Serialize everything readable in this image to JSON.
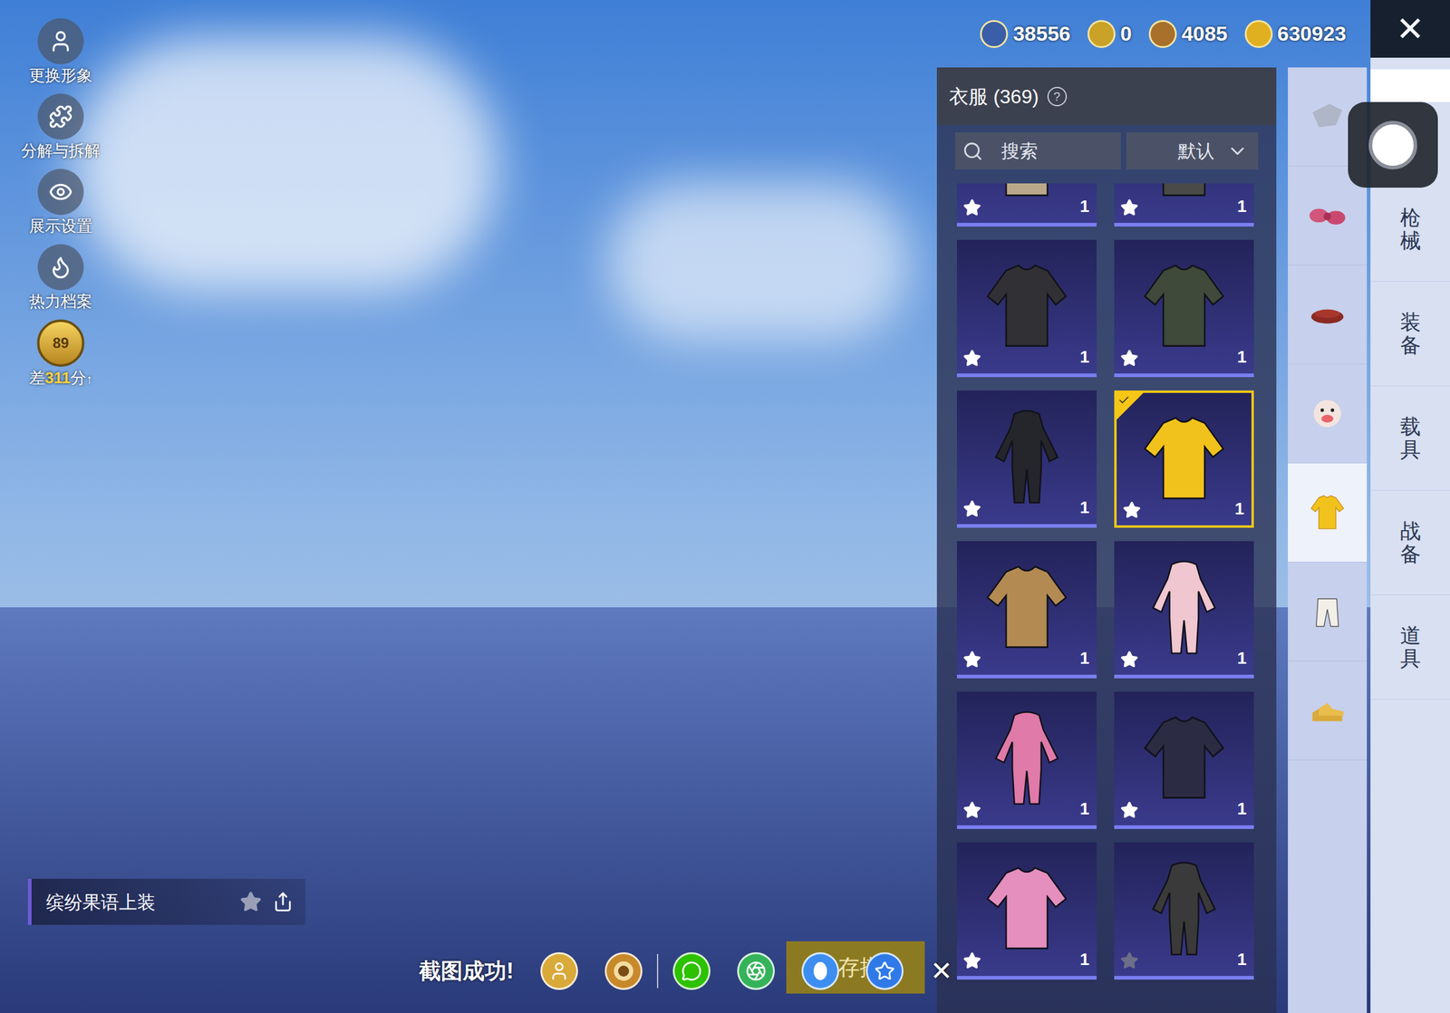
{
  "sidebar": {
    "items": [
      {
        "label": "更换形象",
        "kind": "avatar"
      },
      {
        "label": "分解与拆解",
        "kind": "puzzle"
      },
      {
        "label": "展示设置",
        "kind": "eye"
      },
      {
        "label": "热力档案",
        "kind": "flame"
      }
    ]
  },
  "rank_badge": {
    "level": "89",
    "prefix": "差",
    "points": "311",
    "suffix": "分",
    "arrow": "↑"
  },
  "currencies": [
    {
      "value": "38556",
      "color": "#3b5ea8"
    },
    {
      "value": "0",
      "color": "#c9a227"
    },
    {
      "value": "4085",
      "color": "#a8702a"
    },
    {
      "value": "630923",
      "color": "#e0b020"
    }
  ],
  "close_button": "✕",
  "panel": {
    "title": "衣服 (369)",
    "help": "?",
    "search": {
      "placeholder": "搜索"
    },
    "sort": {
      "value": "默认"
    }
  },
  "items": [
    {
      "kind": "top",
      "color": "#b9a98a",
      "count": "1",
      "starred": true,
      "selected": false
    },
    {
      "kind": "top",
      "color": "#4a4a48",
      "count": "1",
      "starred": true,
      "selected": false
    },
    {
      "kind": "top",
      "color": "#303035",
      "count": "1",
      "starred": true,
      "selected": false
    },
    {
      "kind": "top",
      "color": "#3f4a3a",
      "count": "1",
      "starred": true,
      "selected": false
    },
    {
      "kind": "full",
      "color": "#25262c",
      "count": "1",
      "starred": true,
      "selected": false
    },
    {
      "kind": "top",
      "color": "#f2c21c",
      "count": "1",
      "starred": true,
      "selected": true
    },
    {
      "kind": "top",
      "color": "#b38a52",
      "count": "1",
      "starred": true,
      "selected": false
    },
    {
      "kind": "full",
      "color": "#f0c6d0",
      "count": "1",
      "starred": true,
      "selected": false
    },
    {
      "kind": "full",
      "color": "#e07aa8",
      "count": "1",
      "starred": true,
      "selected": false
    },
    {
      "kind": "top",
      "color": "#2b2b44",
      "count": "1",
      "starred": true,
      "selected": false
    },
    {
      "kind": "top",
      "color": "#e58fbf",
      "count": "1",
      "starred": true,
      "selected": false
    },
    {
      "kind": "full",
      "color": "#3a3a3a",
      "count": "1",
      "starred": false,
      "selected": false
    }
  ],
  "categories": [
    {
      "kind": "gear",
      "selected": false
    },
    {
      "kind": "bow",
      "selected": false
    },
    {
      "kind": "hat",
      "selected": false
    },
    {
      "kind": "mask",
      "selected": false
    },
    {
      "kind": "shirt",
      "selected": true
    },
    {
      "kind": "pants",
      "selected": false
    },
    {
      "kind": "shoes",
      "selected": false
    }
  ],
  "tabs": [
    {
      "label": "枪械",
      "selected": false
    },
    {
      "label": "装备",
      "selected": false
    },
    {
      "label": "载具",
      "selected": false
    },
    {
      "label": "战备",
      "selected": false
    },
    {
      "label": "道具",
      "selected": false
    }
  ],
  "outfit_name": "缤纷果语上装",
  "toast": {
    "message": "截图成功!",
    "save_button": "存搭",
    "close": "✕",
    "targets": [
      {
        "kind": "avatar",
        "color": "#d9a93a"
      },
      {
        "kind": "logo",
        "color": "#c8892a"
      },
      {
        "kind": "wechat",
        "color": "#2dc100"
      },
      {
        "kind": "moments",
        "color": "#35b35a"
      },
      {
        "kind": "qq",
        "color": "#3d8ef0"
      },
      {
        "kind": "qzone",
        "color": "#2f7ae8"
      }
    ]
  }
}
